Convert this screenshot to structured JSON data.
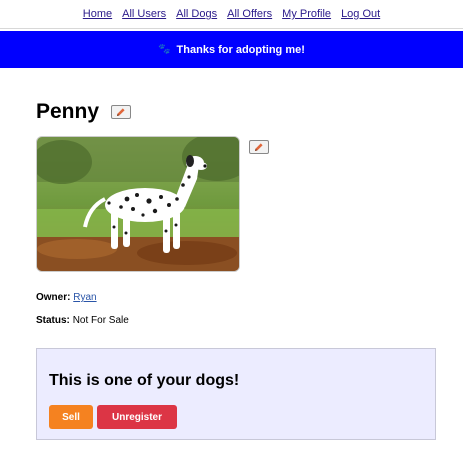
{
  "nav": {
    "items": [
      "Home",
      "All Users",
      "All Dogs",
      "All Offers",
      "My Profile",
      "Log Out"
    ]
  },
  "banner": {
    "icon": "paw-icon",
    "message": "Thanks for adopting me!"
  },
  "dog": {
    "name": "Penny",
    "owner_label": "Owner:",
    "owner": "Ryan",
    "status_label": "Status:",
    "status": "Not For Sale"
  },
  "panel": {
    "heading": "This is one of your dogs!",
    "sell_label": "Sell",
    "unregister_label": "Unregister"
  },
  "colors": {
    "banner": "#0000ff",
    "sell": "#f58220",
    "unregister": "#dc3545",
    "panel": "#ececff"
  }
}
